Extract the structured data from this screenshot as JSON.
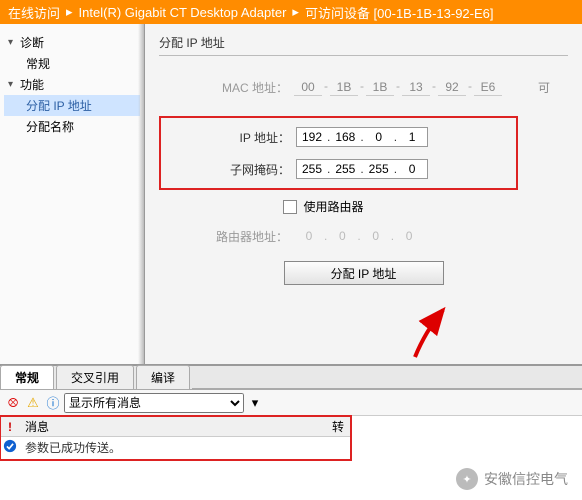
{
  "breadcrumb": {
    "item1": "在线访问",
    "item2": "Intel(R) Gigabit CT Desktop Adapter",
    "item3": "可访问设备 [00-1B-1B-13-92-E6]"
  },
  "tree": {
    "diag": "诊断",
    "general": "常规",
    "func": "功能",
    "assign_ip": "分配 IP 地址",
    "assign_name": "分配名称"
  },
  "form": {
    "title": "分配 IP 地址",
    "mac_label": "MAC 地址：",
    "mac": [
      "00",
      "1B",
      "1B",
      "13",
      "92",
      "E6"
    ],
    "mac_side": "可",
    "ip_label": "IP 地址：",
    "ip": [
      "192",
      "168",
      "0",
      "1"
    ],
    "mask_label": "子网掩码：",
    "mask": [
      "255",
      "255",
      "255",
      "0"
    ],
    "router_chk": "使用路由器",
    "router_label": "路由器地址：",
    "router": [
      "0",
      "0",
      "0",
      "0"
    ],
    "assign_btn": "分配 IP 地址"
  },
  "tabs": {
    "general": "常规",
    "xref": "交叉引用",
    "compile": "编译"
  },
  "msgbar": {
    "filter": "显示所有消息"
  },
  "msgheader": {
    "icon": "!",
    "msg": "消息",
    "right": "转"
  },
  "messages": [
    {
      "text": "参数已成功传送。"
    }
  ],
  "watermark": "安徽信控电气"
}
